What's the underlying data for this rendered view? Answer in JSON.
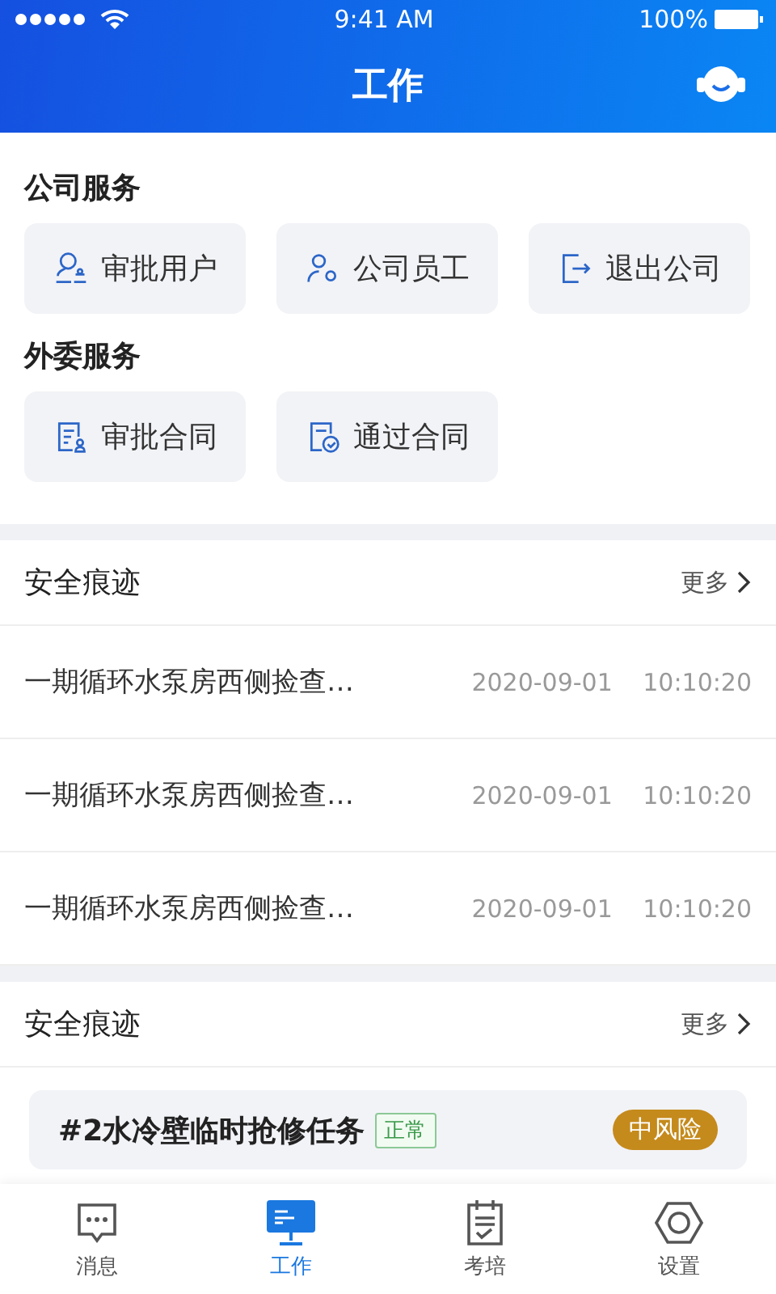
{
  "status_bar": {
    "time": "9:41 AM",
    "battery": "100%"
  },
  "header": {
    "title": "工作"
  },
  "service_groups": [
    {
      "title": "公司服务",
      "items": [
        {
          "label": "审批用户",
          "kind": "approve-user"
        },
        {
          "label": "公司员工",
          "kind": "staff"
        },
        {
          "label": "退出公司",
          "kind": "exit"
        }
      ]
    },
    {
      "title": "外委服务",
      "items": [
        {
          "label": "审批合同",
          "kind": "contract-user"
        },
        {
          "label": "通过合同",
          "kind": "contract-check"
        }
      ]
    }
  ],
  "trace_section": {
    "title": "安全痕迹",
    "more": "更多",
    "rows": [
      {
        "text": "一期循环水泵房西侧捡查…",
        "date": "2020-09-01",
        "time": "10:10:20"
      },
      {
        "text": "一期循环水泵房西侧捡查…",
        "date": "2020-09-01",
        "time": "10:10:20"
      },
      {
        "text": "一期循环水泵房西侧捡查…",
        "date": "2020-09-01",
        "time": "10:10:20"
      }
    ]
  },
  "task_section": {
    "title": "安全痕迹",
    "more": "更多",
    "tasks": [
      {
        "title": "#2水冷壁临时抢修任务",
        "status": "正常",
        "risk": "中风险",
        "color": "#c58a1c"
      }
    ]
  },
  "tab_bar": [
    {
      "label": "消息",
      "kind": "message",
      "selected": false
    },
    {
      "label": "工作",
      "kind": "work",
      "selected": true
    },
    {
      "label": "考培",
      "kind": "exam",
      "selected": false
    },
    {
      "label": "设置",
      "kind": "settings",
      "selected": false
    }
  ]
}
